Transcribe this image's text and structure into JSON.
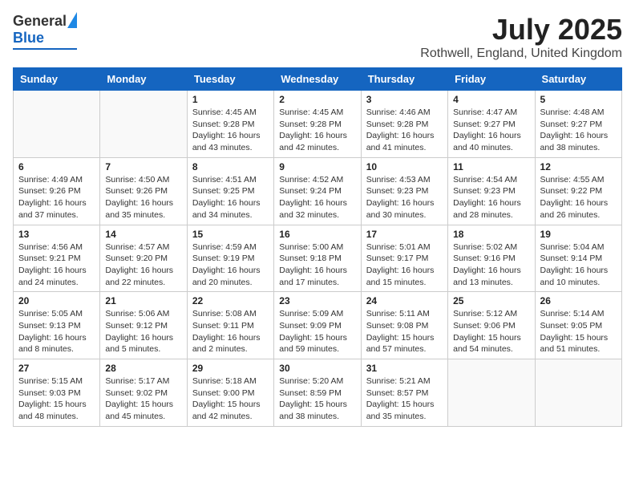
{
  "header": {
    "logo_general": "General",
    "logo_blue": "Blue",
    "month_title": "July 2025",
    "location": "Rothwell, England, United Kingdom"
  },
  "weekdays": [
    "Sunday",
    "Monday",
    "Tuesday",
    "Wednesday",
    "Thursday",
    "Friday",
    "Saturday"
  ],
  "weeks": [
    [
      {
        "day": "",
        "sunrise": "",
        "sunset": "",
        "daylight": ""
      },
      {
        "day": "",
        "sunrise": "",
        "sunset": "",
        "daylight": ""
      },
      {
        "day": "1",
        "sunrise": "Sunrise: 4:45 AM",
        "sunset": "Sunset: 9:28 PM",
        "daylight": "Daylight: 16 hours and 43 minutes."
      },
      {
        "day": "2",
        "sunrise": "Sunrise: 4:45 AM",
        "sunset": "Sunset: 9:28 PM",
        "daylight": "Daylight: 16 hours and 42 minutes."
      },
      {
        "day": "3",
        "sunrise": "Sunrise: 4:46 AM",
        "sunset": "Sunset: 9:28 PM",
        "daylight": "Daylight: 16 hours and 41 minutes."
      },
      {
        "day": "4",
        "sunrise": "Sunrise: 4:47 AM",
        "sunset": "Sunset: 9:27 PM",
        "daylight": "Daylight: 16 hours and 40 minutes."
      },
      {
        "day": "5",
        "sunrise": "Sunrise: 4:48 AM",
        "sunset": "Sunset: 9:27 PM",
        "daylight": "Daylight: 16 hours and 38 minutes."
      }
    ],
    [
      {
        "day": "6",
        "sunrise": "Sunrise: 4:49 AM",
        "sunset": "Sunset: 9:26 PM",
        "daylight": "Daylight: 16 hours and 37 minutes."
      },
      {
        "day": "7",
        "sunrise": "Sunrise: 4:50 AM",
        "sunset": "Sunset: 9:26 PM",
        "daylight": "Daylight: 16 hours and 35 minutes."
      },
      {
        "day": "8",
        "sunrise": "Sunrise: 4:51 AM",
        "sunset": "Sunset: 9:25 PM",
        "daylight": "Daylight: 16 hours and 34 minutes."
      },
      {
        "day": "9",
        "sunrise": "Sunrise: 4:52 AM",
        "sunset": "Sunset: 9:24 PM",
        "daylight": "Daylight: 16 hours and 32 minutes."
      },
      {
        "day": "10",
        "sunrise": "Sunrise: 4:53 AM",
        "sunset": "Sunset: 9:23 PM",
        "daylight": "Daylight: 16 hours and 30 minutes."
      },
      {
        "day": "11",
        "sunrise": "Sunrise: 4:54 AM",
        "sunset": "Sunset: 9:23 PM",
        "daylight": "Daylight: 16 hours and 28 minutes."
      },
      {
        "day": "12",
        "sunrise": "Sunrise: 4:55 AM",
        "sunset": "Sunset: 9:22 PM",
        "daylight": "Daylight: 16 hours and 26 minutes."
      }
    ],
    [
      {
        "day": "13",
        "sunrise": "Sunrise: 4:56 AM",
        "sunset": "Sunset: 9:21 PM",
        "daylight": "Daylight: 16 hours and 24 minutes."
      },
      {
        "day": "14",
        "sunrise": "Sunrise: 4:57 AM",
        "sunset": "Sunset: 9:20 PM",
        "daylight": "Daylight: 16 hours and 22 minutes."
      },
      {
        "day": "15",
        "sunrise": "Sunrise: 4:59 AM",
        "sunset": "Sunset: 9:19 PM",
        "daylight": "Daylight: 16 hours and 20 minutes."
      },
      {
        "day": "16",
        "sunrise": "Sunrise: 5:00 AM",
        "sunset": "Sunset: 9:18 PM",
        "daylight": "Daylight: 16 hours and 17 minutes."
      },
      {
        "day": "17",
        "sunrise": "Sunrise: 5:01 AM",
        "sunset": "Sunset: 9:17 PM",
        "daylight": "Daylight: 16 hours and 15 minutes."
      },
      {
        "day": "18",
        "sunrise": "Sunrise: 5:02 AM",
        "sunset": "Sunset: 9:16 PM",
        "daylight": "Daylight: 16 hours and 13 minutes."
      },
      {
        "day": "19",
        "sunrise": "Sunrise: 5:04 AM",
        "sunset": "Sunset: 9:14 PM",
        "daylight": "Daylight: 16 hours and 10 minutes."
      }
    ],
    [
      {
        "day": "20",
        "sunrise": "Sunrise: 5:05 AM",
        "sunset": "Sunset: 9:13 PM",
        "daylight": "Daylight: 16 hours and 8 minutes."
      },
      {
        "day": "21",
        "sunrise": "Sunrise: 5:06 AM",
        "sunset": "Sunset: 9:12 PM",
        "daylight": "Daylight: 16 hours and 5 minutes."
      },
      {
        "day": "22",
        "sunrise": "Sunrise: 5:08 AM",
        "sunset": "Sunset: 9:11 PM",
        "daylight": "Daylight: 16 hours and 2 minutes."
      },
      {
        "day": "23",
        "sunrise": "Sunrise: 5:09 AM",
        "sunset": "Sunset: 9:09 PM",
        "daylight": "Daylight: 15 hours and 59 minutes."
      },
      {
        "day": "24",
        "sunrise": "Sunrise: 5:11 AM",
        "sunset": "Sunset: 9:08 PM",
        "daylight": "Daylight: 15 hours and 57 minutes."
      },
      {
        "day": "25",
        "sunrise": "Sunrise: 5:12 AM",
        "sunset": "Sunset: 9:06 PM",
        "daylight": "Daylight: 15 hours and 54 minutes."
      },
      {
        "day": "26",
        "sunrise": "Sunrise: 5:14 AM",
        "sunset": "Sunset: 9:05 PM",
        "daylight": "Daylight: 15 hours and 51 minutes."
      }
    ],
    [
      {
        "day": "27",
        "sunrise": "Sunrise: 5:15 AM",
        "sunset": "Sunset: 9:03 PM",
        "daylight": "Daylight: 15 hours and 48 minutes."
      },
      {
        "day": "28",
        "sunrise": "Sunrise: 5:17 AM",
        "sunset": "Sunset: 9:02 PM",
        "daylight": "Daylight: 15 hours and 45 minutes."
      },
      {
        "day": "29",
        "sunrise": "Sunrise: 5:18 AM",
        "sunset": "Sunset: 9:00 PM",
        "daylight": "Daylight: 15 hours and 42 minutes."
      },
      {
        "day": "30",
        "sunrise": "Sunrise: 5:20 AM",
        "sunset": "Sunset: 8:59 PM",
        "daylight": "Daylight: 15 hours and 38 minutes."
      },
      {
        "day": "31",
        "sunrise": "Sunrise: 5:21 AM",
        "sunset": "Sunset: 8:57 PM",
        "daylight": "Daylight: 15 hours and 35 minutes."
      },
      {
        "day": "",
        "sunrise": "",
        "sunset": "",
        "daylight": ""
      },
      {
        "day": "",
        "sunrise": "",
        "sunset": "",
        "daylight": ""
      }
    ]
  ]
}
